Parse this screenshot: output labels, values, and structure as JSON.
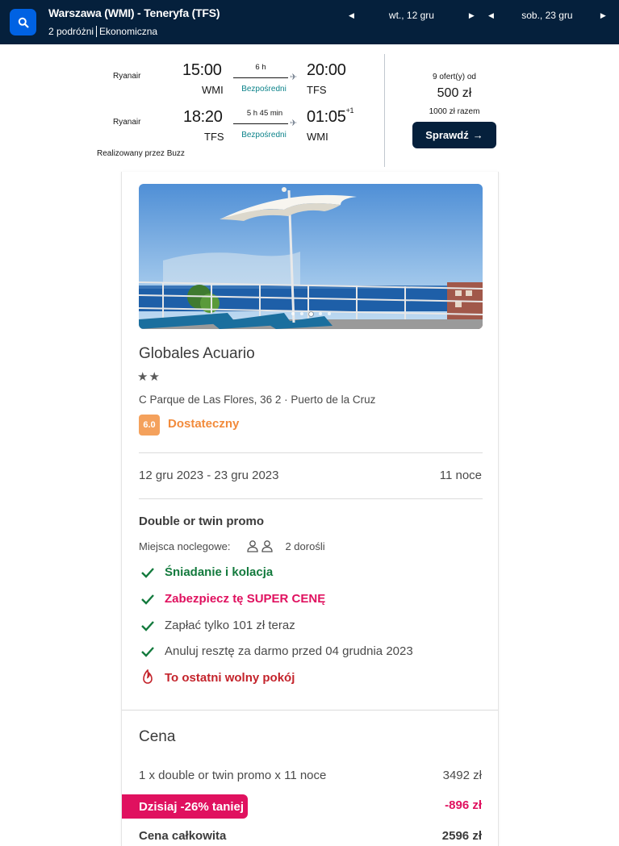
{
  "search": {
    "route": "Warszawa (WMI) - Teneryfa (TFS)",
    "travellers": "2 podróżni",
    "cabin": "Ekonomiczna",
    "outbound_date": "wt., 12 gru",
    "return_date": "sob., 23 gru"
  },
  "flight": {
    "outbound": {
      "airline": "Ryanair",
      "depart_time": "15:00",
      "depart_code": "WMI",
      "duration": "6 h",
      "stops": "Bezpośredni",
      "arrive_time": "20:00",
      "arrive_code": "TFS"
    },
    "inbound": {
      "airline": "Ryanair",
      "depart_time": "18:20",
      "depart_code": "TFS",
      "duration": "5 h 45 min",
      "stops": "Bezpośredni",
      "arrive_time": "01:05",
      "day_offset": "+1",
      "arrive_code": "WMI"
    },
    "operated_by": "Realizowany przez Buzz",
    "offers": "9 ofert(y) od",
    "price": "500 zł",
    "total": "1000 zł razem",
    "check_button": "Sprawdź"
  },
  "hotel": {
    "carousel": {
      "count": 5,
      "active_index": 2
    },
    "name": "Globales Acuario",
    "stars": 2,
    "address": "C Parque de Las Flores, 36 2 · Puerto de la Cruz",
    "rating_score": "6.0",
    "rating_label": "Dostateczny",
    "dates": "12 gru 2023 - 23 gru 2023",
    "nights": "11 noce",
    "room_type": "Double or twin promo",
    "beds_label": "Miejsca noclegowe:",
    "beds_value": "2 dorośli",
    "features": [
      {
        "icon": "check-icon",
        "text": "Śniadanie i kolacja"
      },
      {
        "icon": "check-icon",
        "text": "Zabezpiecz tę SUPER CENĘ"
      },
      {
        "icon": "check-icon",
        "text": "Zapłać tylko 101 zł teraz"
      },
      {
        "icon": "check-icon",
        "text": "Anuluj resztę za darmo przed 04 grudnia 2023"
      },
      {
        "icon": "flame-icon",
        "text": "To ostatni wolny pokój"
      }
    ]
  },
  "price_breakdown": {
    "title": "Cena",
    "line_label": "1 x double or twin promo x 11 noce",
    "line_value": "3492 zł",
    "discount_label": "Dzisiaj -26% taniej",
    "discount_value": "-896 zł",
    "total_label": "Cena całkowita",
    "total_value": "2596 zł"
  },
  "colors": {
    "header_bg": "#05203c",
    "search_button": "#0062e3",
    "direct_text": "#0c838a",
    "rating_badge": "#f4a15c",
    "feature_green": "#137a3d",
    "promo_pink": "#e0115f",
    "urgent_red": "#c4242c"
  }
}
